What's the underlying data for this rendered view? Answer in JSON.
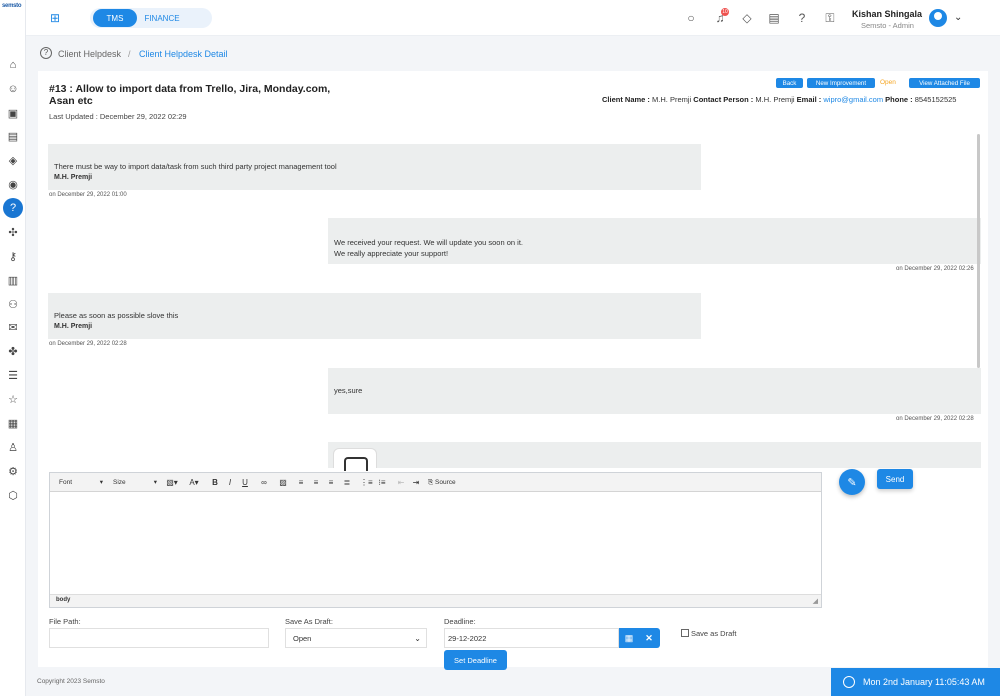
{
  "app": {
    "logo_text": "semsto"
  },
  "header": {
    "switch": {
      "tms": "TMS",
      "finance": "FINANCE"
    },
    "notification_count": "10",
    "user": {
      "name": "Kishan Shingala",
      "role": "Semsto - Admin"
    }
  },
  "breadcrumb": {
    "parent": "Client Helpdesk",
    "separator": "/",
    "current": "Client Helpdesk Detail"
  },
  "ticket": {
    "title": "#13 : Allow to import data from Trello, Jira, Monday.com, Asan etc",
    "last_updated": "Last Updated : December 29, 2022 02:29",
    "buttons": {
      "back": "Back",
      "new_improvement": "New Improvement",
      "view_attached": "View Attached File"
    },
    "status": "Open",
    "client": {
      "name_label": "Client Name :",
      "name": "M.H. Premji",
      "contact_label": "Contact Person :",
      "contact": "M.H. Premji",
      "email_label": "Email :",
      "email": "wipro@gmail.com",
      "phone_label": "Phone :",
      "phone": "8545152525"
    }
  },
  "messages": [
    {
      "text": "There must be way to import data/task from such third party project management tool",
      "author": "M.H. Premji",
      "time": "on December 29, 2022 01:00"
    },
    {
      "text": "We received your request. We will update you soon on it.",
      "text2": "We really appreciate your support!",
      "time": "on December 29, 2022 02:26"
    },
    {
      "text": "Please as soon as possible slove this",
      "author": "M.H. Premji",
      "time": "on December 29, 2022 02:28"
    },
    {
      "text": "yes,sure",
      "time": "on December 29, 2022 02:28"
    }
  ],
  "editor": {
    "font": "Font",
    "size": "Size",
    "source": "Source",
    "path": "body"
  },
  "send_label": "Send",
  "form": {
    "file_path_label": "File Path:",
    "save_as_draft_label": "Save As Draft:",
    "save_as_draft_value": "Open",
    "deadline_label": "Deadline:",
    "deadline_value": "29-12-2022",
    "save_as_draft_check": "Save as Draft",
    "set_deadline": "Set Deadline"
  },
  "footer": {
    "copyright": "Copyright 2023 Semsto",
    "clock": "Mon 2nd January 11:05:43 AM"
  }
}
